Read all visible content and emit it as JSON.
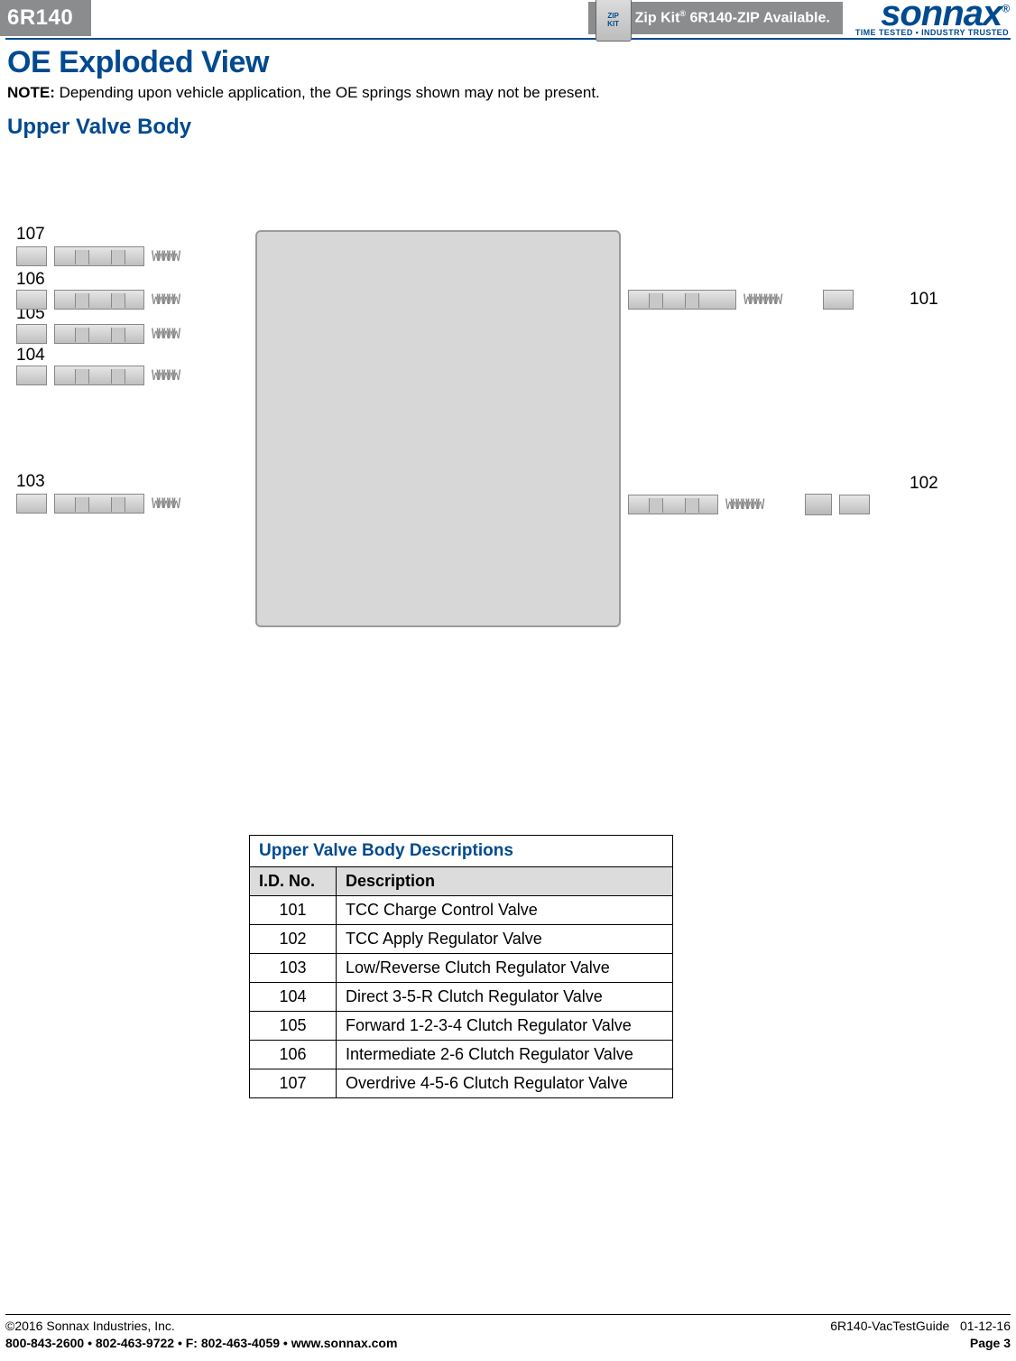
{
  "header": {
    "product": "6R140",
    "zipkit_prefix": "Zip Kit",
    "zipkit_reg": "®",
    "zipkit_code": "6R140-ZIP",
    "zipkit_suffix": "Available.",
    "logo": "sonnax",
    "logo_reg": "®",
    "tagline": "TIME TESTED • INDUSTRY TRUSTED"
  },
  "title": "OE Exploded View",
  "note_label": "NOTE:",
  "note_text": "Depending upon vehicle application, the OE springs shown may not be present.",
  "section": "Upper Valve Body",
  "callouts": {
    "c101": "101",
    "c102": "102",
    "c103": "103",
    "c104": "104",
    "c105": "105",
    "c106": "106",
    "c107": "107"
  },
  "table": {
    "title": "Upper Valve Body Descriptions",
    "col_id": "I.D. No.",
    "col_desc": "Description",
    "rows": [
      {
        "id": "101",
        "desc": "TCC Charge Control Valve"
      },
      {
        "id": "102",
        "desc": "TCC Apply Regulator Valve"
      },
      {
        "id": "103",
        "desc": "Low/Reverse Clutch Regulator Valve"
      },
      {
        "id": "104",
        "desc": "Direct 3-5-R Clutch Regulator Valve"
      },
      {
        "id": "105",
        "desc": "Forward 1-2-3-4 Clutch Regulator Valve"
      },
      {
        "id": "106",
        "desc": "Intermediate 2-6 Clutch Regulator Valve"
      },
      {
        "id": "107",
        "desc": "Overdrive 4-5-6 Clutch Regulator Valve"
      }
    ]
  },
  "footer": {
    "copyright": "©2016 Sonnax Industries, Inc.",
    "docid": "6R140-VacTestGuide",
    "date": "01-12-16",
    "contact": "800-843-2600 • 802-463-9722 • F: 802-463-4059 • www.sonnax.com",
    "page": "Page 3"
  }
}
